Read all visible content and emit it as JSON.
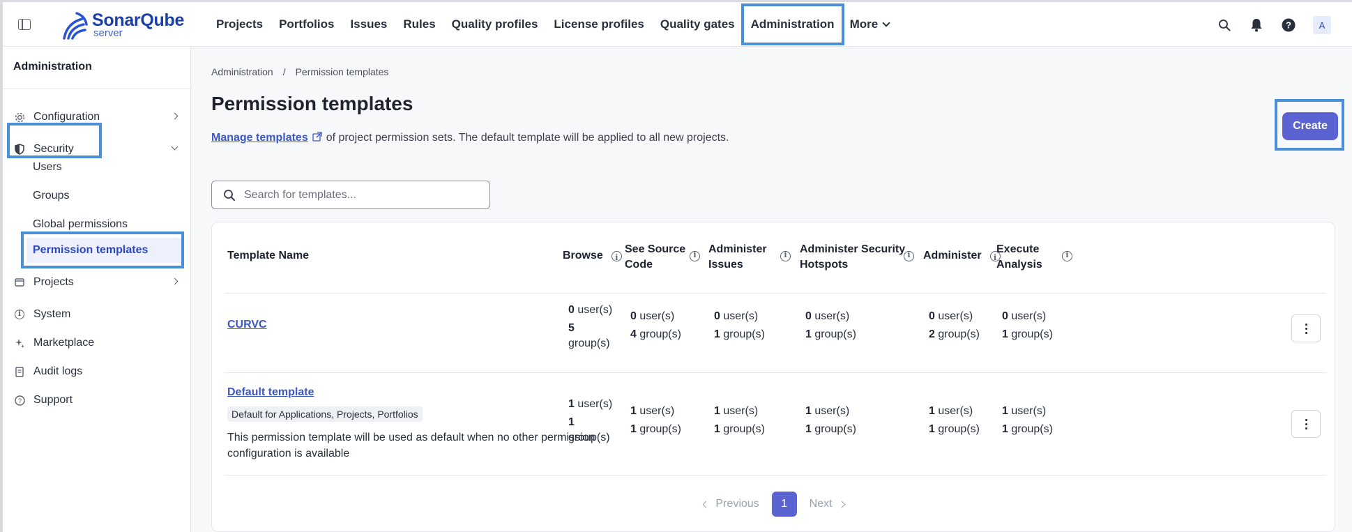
{
  "brand": {
    "name": "SonarQube",
    "sub": "server"
  },
  "topnav": {
    "items": [
      "Projects",
      "Portfolios",
      "Issues",
      "Rules",
      "Quality profiles",
      "License profiles",
      "Quality gates",
      "Administration",
      "More"
    ],
    "avatar": "A"
  },
  "sidebar": {
    "title": "Administration",
    "items": {
      "configuration": "Configuration",
      "security": "Security",
      "projects": "Projects",
      "system": "System",
      "marketplace": "Marketplace",
      "audit_logs": "Audit logs",
      "support": "Support"
    },
    "security_sub": [
      "Users",
      "Groups",
      "Global permissions",
      "Permission templates"
    ]
  },
  "breadcrumb": {
    "root": "Administration",
    "sep": "/",
    "current": "Permission templates"
  },
  "page": {
    "title": "Permission templates",
    "desc_link": "Manage templates",
    "desc_text": "of project permission sets. The default template will be applied to all new projects.",
    "create_label": "Create"
  },
  "search": {
    "placeholder": "Search for templates..."
  },
  "table": {
    "headers": {
      "name": "Template Name",
      "browse": "Browse",
      "see_source": "See Source Code",
      "admin_issues": "Administer Issues",
      "admin_hotspots": "Administer Security Hotspots",
      "administer": "Administer",
      "execute": "Execute Analysis"
    },
    "unit_users": "user(s)",
    "unit_groups": "group(s)",
    "rows": [
      {
        "name": "CURVC",
        "perms": [
          {
            "users": "0",
            "groups": "5"
          },
          {
            "users": "0",
            "groups": "4"
          },
          {
            "users": "0",
            "groups": "1"
          },
          {
            "users": "0",
            "groups": "1"
          },
          {
            "users": "0",
            "groups": "2"
          },
          {
            "users": "0",
            "groups": "1"
          }
        ]
      },
      {
        "name": "Default template",
        "badge": "Default for Applications, Projects, Portfolios",
        "description": "This permission template will be used as default when no other permission configuration is available",
        "perms": [
          {
            "users": "1",
            "groups": "1"
          },
          {
            "users": "1",
            "groups": "1"
          },
          {
            "users": "1",
            "groups": "1"
          },
          {
            "users": "1",
            "groups": "1"
          },
          {
            "users": "1",
            "groups": "1"
          },
          {
            "users": "1",
            "groups": "1"
          }
        ]
      }
    ]
  },
  "pager": {
    "previous": "Previous",
    "current": "1",
    "next": "Next"
  }
}
